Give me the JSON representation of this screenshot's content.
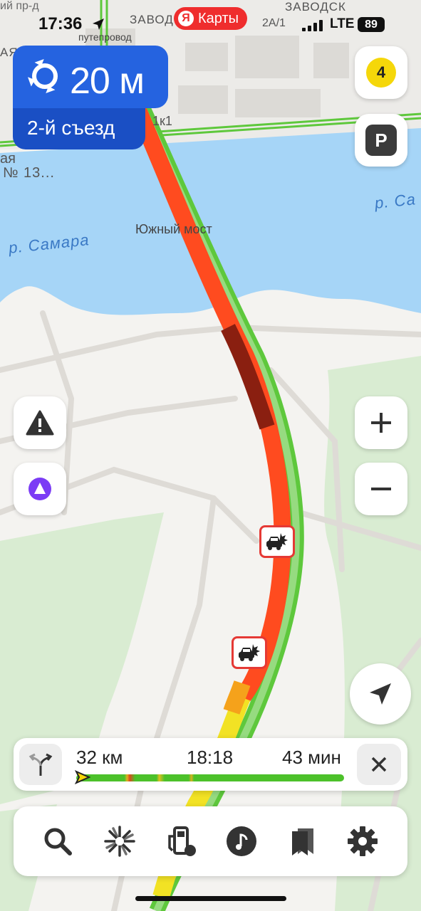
{
  "status_bar": {
    "time": "17:36",
    "app_badge": "Карты",
    "app_badge_letter": "Я",
    "network": "LTE",
    "battery": "89"
  },
  "maneuver": {
    "icon": "roundabout-icon",
    "distance": "20 м",
    "exit": "2-й съезд"
  },
  "map_labels": {
    "street_top_left": "ий пр-д",
    "zavod_1": "ЗАВОД",
    "zavod_2": "ЗАВОДСК",
    "overpass": "путепровод",
    "street_ul": "АЯ УЛ.",
    "label_1k1": "1к1",
    "label_13": "№ 13...",
    "label_aya": "ая",
    "label_2a1": "2А/1",
    "bridge": "Южный мост",
    "river_left": "р. Самара",
    "river_right": "р. Са"
  },
  "top_controls": {
    "traffic_score": "4",
    "parking_label": "P"
  },
  "route_summary": {
    "distance": "32 км",
    "arrival_time": "18:18",
    "duration": "43 мин"
  },
  "bottom_nav": [
    {
      "name": "search",
      "icon": "search-icon"
    },
    {
      "name": "discover",
      "icon": "sparkle-icon"
    },
    {
      "name": "fuel",
      "icon": "gas-station-icon"
    },
    {
      "name": "music",
      "icon": "music-note-icon"
    },
    {
      "name": "bookmarks",
      "icon": "bookmarks-icon"
    },
    {
      "name": "settings",
      "icon": "gear-icon"
    }
  ],
  "colors": {
    "accent_blue": "#2563e0",
    "traffic_red": "#ff4b1f",
    "traffic_green": "#4cc12a",
    "traffic_yellow": "#f2e224",
    "water": "#a6d5f7"
  }
}
